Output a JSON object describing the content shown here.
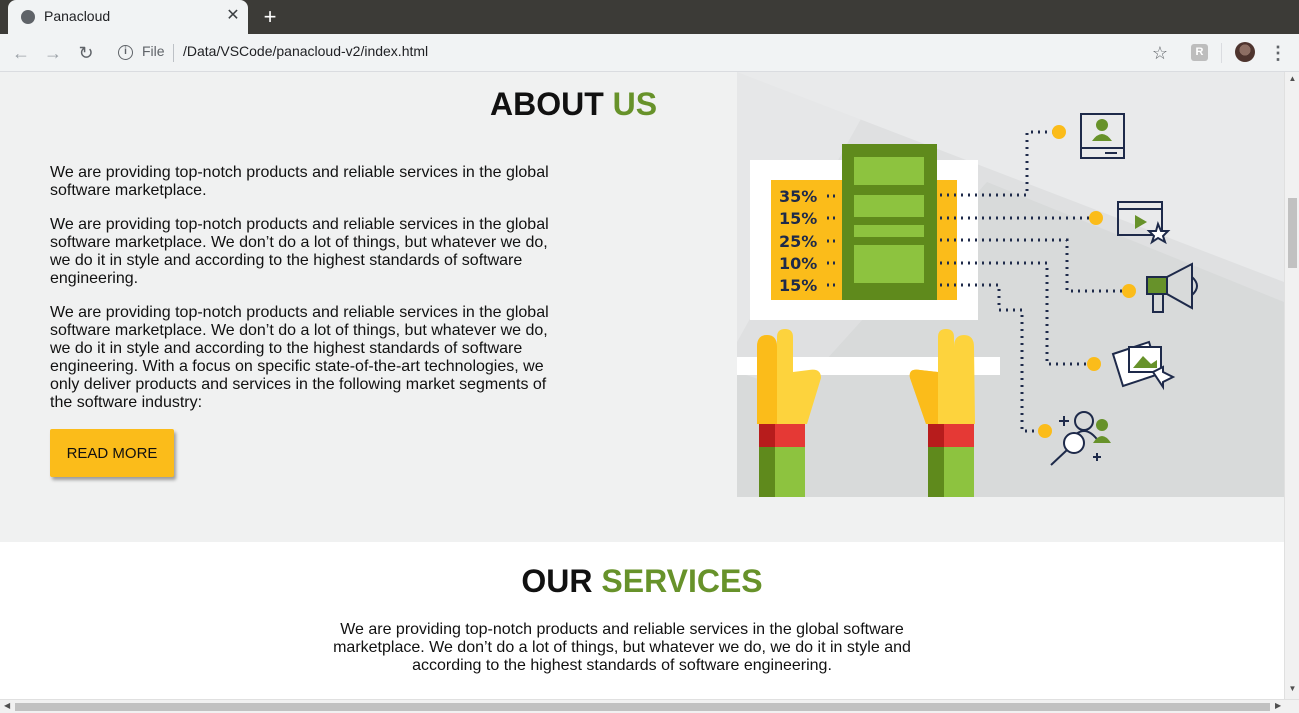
{
  "browser": {
    "tab_title": "Panacloud",
    "tab_close": "✕",
    "new_tab": "+",
    "back": "←",
    "forward": "→",
    "reload": "↻",
    "scheme_label": "File",
    "url": "/Data/VSCode/panacloud-v2/index.html",
    "star": "☆",
    "extension_letter": "R",
    "menu": "⋮"
  },
  "about": {
    "title_part1": "ABOUT",
    "title_part2": "US",
    "paragraphs": [
      "We are providing top-notch products and reliable services in the global software marketplace.",
      "We are providing top-notch products and reliable services in the global software marketplace. We don’t do a lot of things, but whatever we do, we do it in style and according to the highest standards of software engineering.",
      "We are providing top-notch products and reliable services in the global software marketplace. We don’t do a lot of things, but whatever we do, we do it in style and according to the highest standards of software engineering. With a focus on specific state-of-the-art technologies, we only deliver products and services in the following market segments of the software industry:"
    ],
    "button_label": "READ MORE",
    "illustration_percentages": [
      "35%",
      "15%",
      "25%",
      "10%",
      "15%"
    ]
  },
  "services": {
    "title_part1": "OUR",
    "title_part2": "SERVICES",
    "text": "We are providing top-notch products and reliable services in the global software marketplace. We don’t do a lot of things, but whatever we do, we do it in style and according to the highest standards of software engineering."
  },
  "colors": {
    "accent_green": "#67922a",
    "button_yellow": "#fbbc1a",
    "about_bg": "#f0f1f1"
  }
}
